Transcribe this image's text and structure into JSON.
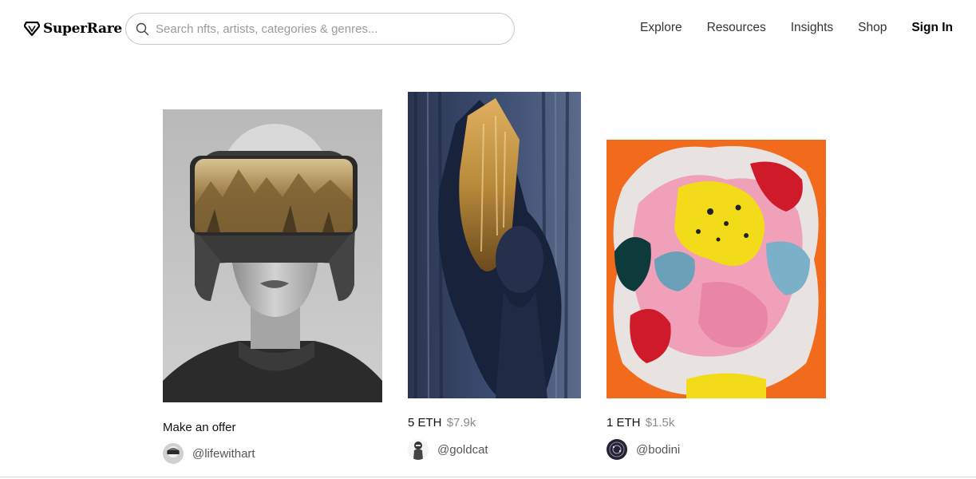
{
  "header": {
    "logo_text": "SuperRare",
    "search_placeholder": "Search nfts, artists, categories & genres...",
    "nav": [
      "Explore",
      "Resources",
      "Insights",
      "Shop"
    ],
    "sign_in": "Sign In"
  },
  "cards": [
    {
      "price_label": "Make an offer",
      "usd": "",
      "artist": "@lifewithart"
    },
    {
      "price_label": "5 ETH",
      "usd": "$7.9k",
      "artist": "@goldcat"
    },
    {
      "price_label": "1 ETH",
      "usd": "$1.5k",
      "artist": "@bodini"
    }
  ]
}
